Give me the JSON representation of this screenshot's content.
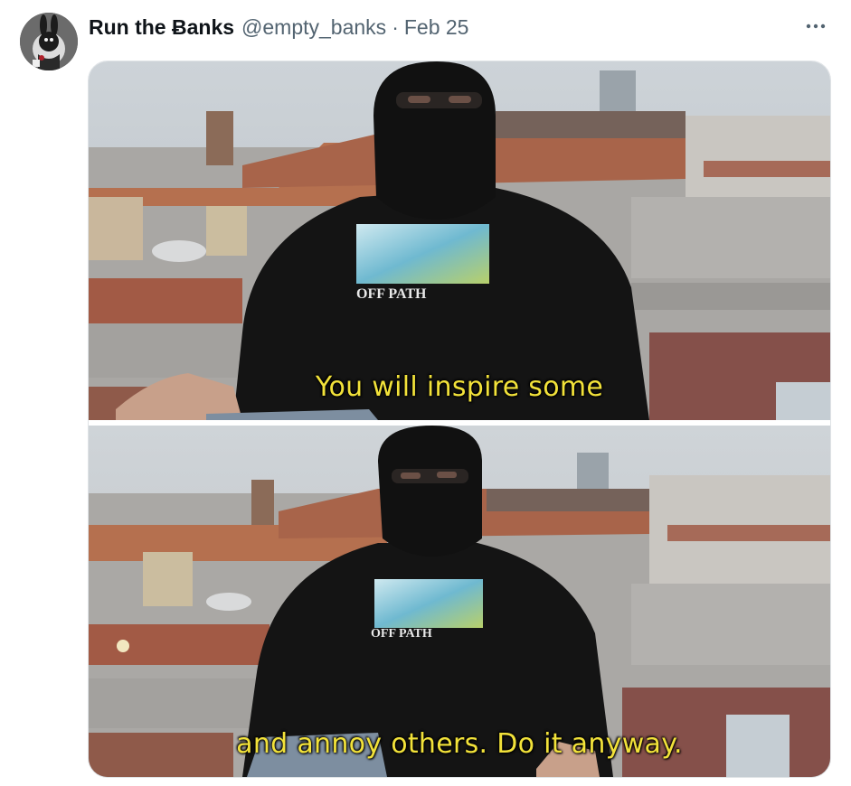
{
  "tweet": {
    "author_name": "Run the Ƀanks",
    "author_handle": "@empty_banks",
    "separator": "·",
    "date": "Feb 25",
    "more_icon": "ellipsis-icon",
    "avatar_icon": "rabbit-avatar-icon"
  },
  "media": {
    "panels": [
      {
        "subtitle": "You will inspire some",
        "hoodie_text": "OFF PATH"
      },
      {
        "subtitle": "and annoy others. Do it anyway.",
        "hoodie_text": "OFF PATH"
      }
    ]
  },
  "colors": {
    "subtitle": "#f2e23a",
    "name": "#0f1419",
    "secondary": "#536471"
  }
}
